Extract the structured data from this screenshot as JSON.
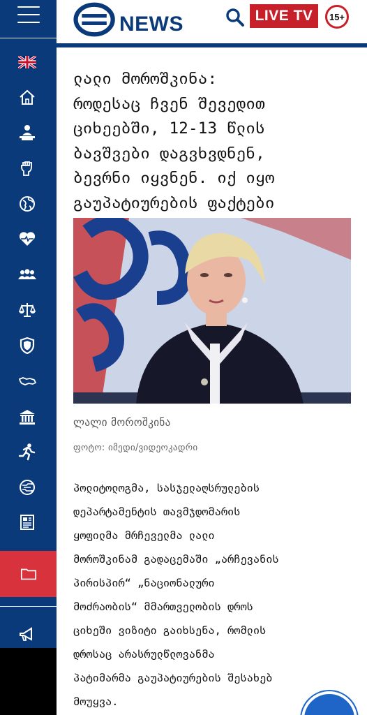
{
  "header": {
    "logo_text": "NEWS",
    "live_label": "LIVE TV",
    "age_rating": "15+"
  },
  "sidebar": {
    "items": [
      {
        "icon": "uk-flag-icon"
      },
      {
        "icon": "home-icon"
      },
      {
        "icon": "person-at-desk-icon"
      },
      {
        "icon": "raised-fist-icon"
      },
      {
        "icon": "globe-icon"
      },
      {
        "icon": "heart-pulse-icon"
      },
      {
        "icon": "group-icon"
      },
      {
        "icon": "scales-icon"
      },
      {
        "icon": "shield-icon"
      },
      {
        "icon": "georgia-map-icon"
      },
      {
        "icon": "institution-icon"
      },
      {
        "icon": "runner-icon"
      },
      {
        "icon": "tech-circle-icon"
      },
      {
        "icon": "newspaper-icon"
      },
      {
        "icon": "folder-icon"
      },
      {
        "icon": "megaphone-icon"
      }
    ],
    "accent_color": "#0b3a7a",
    "active_color": "#d8323d"
  },
  "article": {
    "headline_lines": [
      "ლალი მოროშკინა:",
      "როდესაც ჩვენ შევედით",
      "ციხეებში, 12-13 წლის",
      "ბავშვები დაგვხვდნენ,",
      "ბევრნი იყვნენ. იქ იყო",
      "გაუპატიურების ფაქტები"
    ],
    "photo_caption": "ლალი მოროშკინა",
    "photo_credit": "ფოტო: იმედი/ვიდეოკადრი",
    "body_lines": [
      "პოლიტოლოგმა, სასჯელაღსრულების",
      "დეპარტამენტის თავმჯდომარის",
      "ყოფილმა მრჩეველმა ლალი",
      "მოროშკინამ გადაცემაში „არჩევანის",
      "პირისპირ“ „ნაციონალური",
      "მოძრაობის“ მმართველობის დროს",
      "ციხეში ვიზიტი გაიხსენა, რომლის",
      "დროსაც არასრულწლოვანმა",
      "პატიმარმა გაუპატიურების შესახებ",
      "მოუყვა."
    ]
  },
  "colors": {
    "brand_blue": "#0b3a7a",
    "live_red": "#c8202a",
    "fab_blue": "#1f65c7"
  }
}
